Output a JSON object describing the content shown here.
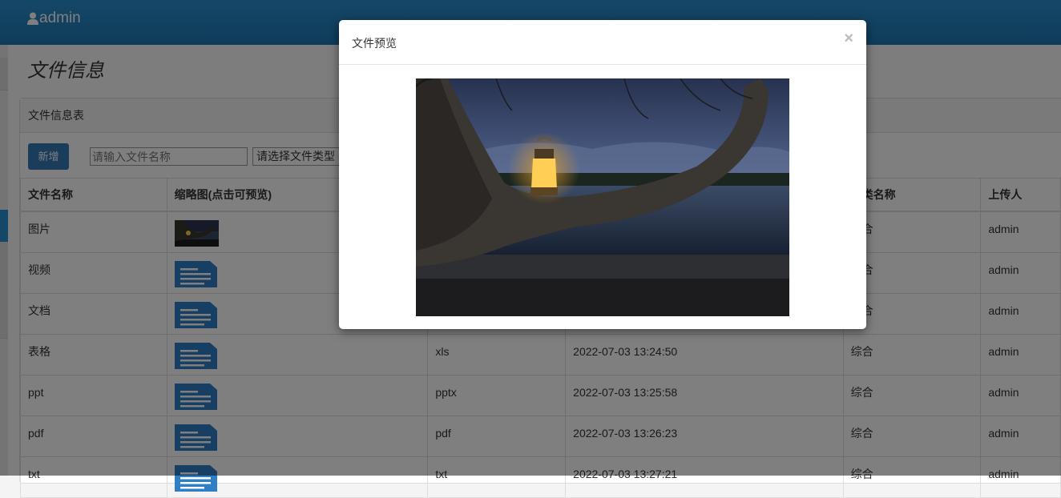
{
  "header": {
    "username": "admin"
  },
  "page": {
    "title": "文件信息"
  },
  "panel": {
    "title": "文件信息表",
    "add_button": "新增",
    "search_placeholder": "请输入文件名称",
    "type_select": "请选择文件类型"
  },
  "table": {
    "columns": [
      "文件名称",
      "缩略图(点击可预览)",
      "",
      "",
      "分类名称",
      "上传人"
    ],
    "rows": [
      {
        "name": "图片",
        "thumb": "image",
        "type": "",
        "time": "",
        "category": "综合",
        "uploader": "admin"
      },
      {
        "name": "视频",
        "thumb": "doc",
        "type": "",
        "time": "",
        "category": "综合",
        "uploader": "admin"
      },
      {
        "name": "文档",
        "thumb": "doc",
        "type": "",
        "time": "",
        "category": "综合",
        "uploader": "admin"
      },
      {
        "name": "表格",
        "thumb": "doc",
        "type": "xls",
        "time": "2022-07-03 13:24:50",
        "category": "综合",
        "uploader": "admin"
      },
      {
        "name": "ppt",
        "thumb": "doc",
        "type": "pptx",
        "time": "2022-07-03 13:25:58",
        "category": "综合",
        "uploader": "admin"
      },
      {
        "name": "pdf",
        "thumb": "doc",
        "type": "pdf",
        "time": "2022-07-03 13:26:23",
        "category": "综合",
        "uploader": "admin"
      },
      {
        "name": "txt",
        "thumb": "doc",
        "type": "txt",
        "time": "2022-07-03 13:27:21",
        "category": "综合",
        "uploader": "admin"
      }
    ]
  },
  "modal": {
    "title": "文件预览",
    "close_label": "×",
    "preview_image": "lantern-on-tree-branch-by-lake-at-dusk"
  },
  "colors": {
    "header": "#1f78b4",
    "primary_button": "#337ab7",
    "doc_icon": "#2f7fc6"
  },
  "icons": {
    "user": "user-icon",
    "document": "document-icon",
    "close": "close-icon"
  }
}
